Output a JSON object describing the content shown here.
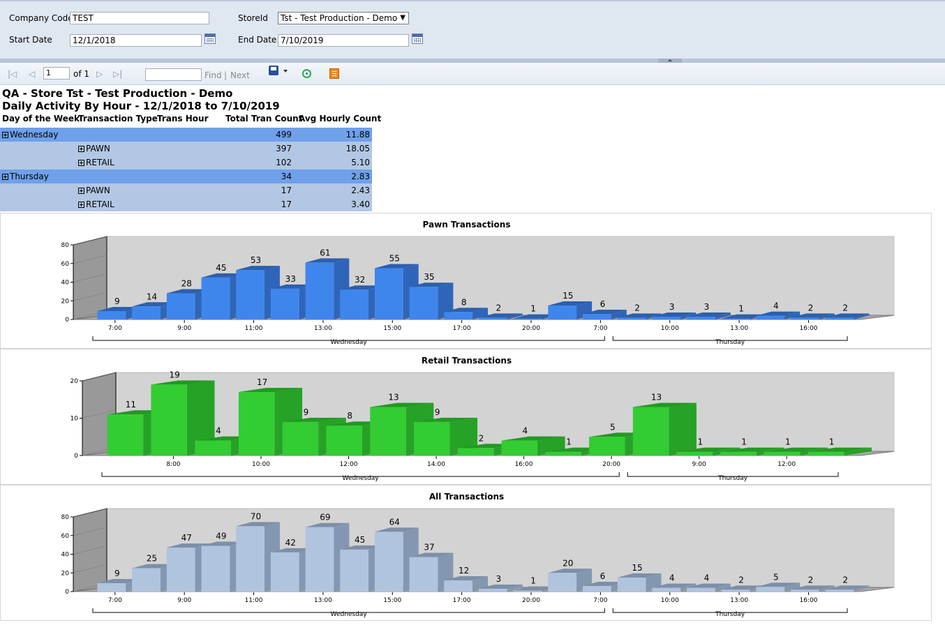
{
  "params": {
    "company_code_label": "Company Code",
    "company_code_value": "TEST",
    "store_label": "StoreId",
    "store_value": "Tst - Test Production - Demo",
    "start_date_label": "Start Date",
    "start_date_value": "12/1/2018",
    "end_date_label": "End Date",
    "end_date_value": "7/10/2019"
  },
  "toolbar": {
    "page_value": "1",
    "of_label": "of 1",
    "find_label": "Find",
    "separator": "|",
    "next_label": "Next"
  },
  "report": {
    "title_line1": "QA - Store Tst - Test Production - Demo",
    "title_line2": "Daily Activity By Hour - 12/1/2018 to  7/10/2019"
  },
  "table": {
    "headers": [
      "Day of the Week",
      "Transaction Type",
      "Trans Hour",
      "Total Tran Count",
      "Avg Hourly Count"
    ],
    "rows": [
      {
        "level": "day",
        "label": "Wednesday",
        "total": "499",
        "avg": "11.88"
      },
      {
        "level": "type",
        "label": "PAWN",
        "total": "397",
        "avg": "18.05"
      },
      {
        "level": "type",
        "label": "RETAIL",
        "total": "102",
        "avg": "5.10"
      },
      {
        "level": "day",
        "label": "Thursday",
        "total": "34",
        "avg": "2.83"
      },
      {
        "level": "type",
        "label": "PAWN",
        "total": "17",
        "avg": "2.43"
      },
      {
        "level": "type",
        "label": "RETAIL",
        "total": "17",
        "avg": "3.40"
      }
    ]
  },
  "colors": {
    "pawn_front": "#3f86ec",
    "pawn_side": "#2f65b8",
    "pawn_top": "#2c5fad",
    "retail_front": "#33cc33",
    "retail_side": "#26a226",
    "retail_top": "#229922",
    "all_front": "#b0c4de",
    "all_side": "#8497b0",
    "all_top": "#7d8fa8",
    "table_day_row": "#6fa0ea",
    "table_type_row": "#b2c7e4",
    "chart_wall": "#d3d3d3",
    "chart_side_wall": "#999999"
  },
  "chart_data": [
    {
      "type": "bar",
      "title": "Pawn Transactions",
      "ylim": [
        0,
        80
      ],
      "yticks": [
        0,
        20,
        40,
        60,
        80
      ],
      "values": [
        9,
        14,
        28,
        45,
        53,
        33,
        61,
        32,
        55,
        35,
        8,
        2,
        1,
        15,
        6,
        2,
        3,
        3,
        1,
        4,
        2,
        2
      ],
      "data_labels": [
        "9",
        "14",
        "28",
        "45",
        "53",
        "33",
        "61",
        "32",
        "55",
        "35",
        "8",
        "2",
        "1",
        "15",
        "6",
        "2",
        "3",
        "3",
        "1",
        "4",
        "2",
        "2"
      ],
      "xticks": [
        {
          "label": "7:00",
          "at": 0.5
        },
        {
          "label": "9:00",
          "at": 2.5
        },
        {
          "label": "11:00",
          "at": 4.5
        },
        {
          "label": "13:00",
          "at": 6.5
        },
        {
          "label": "15:00",
          "at": 8.5
        },
        {
          "label": "17:00",
          "at": 10.5
        },
        {
          "label": "20:00",
          "at": 12.5
        },
        {
          "label": "7:00",
          "at": 14.5
        },
        {
          "label": "10:00",
          "at": 16.5
        },
        {
          "label": "13:00",
          "at": 18.5
        },
        {
          "label": "16:00",
          "at": 20.5
        }
      ],
      "groups": [
        {
          "label": "Wednesday",
          "start": 0,
          "end": 15
        },
        {
          "label": "Thursday",
          "start": 15,
          "end": 22
        }
      ],
      "grid": false
    },
    {
      "type": "bar",
      "title": "Retail Transactions",
      "ylim": [
        0,
        20
      ],
      "yticks": [
        0,
        10,
        20
      ],
      "values": [
        11,
        19,
        4,
        17,
        9,
        8,
        13,
        9,
        2,
        4,
        1,
        5,
        13,
        1,
        1,
        1,
        1
      ],
      "data_labels": [
        "11",
        "19",
        "4",
        "17",
        "9",
        "8",
        "13",
        "9",
        "2",
        "4",
        "1",
        "5",
        "13",
        "1",
        "1",
        "1",
        "1"
      ],
      "xticks": [
        {
          "label": "8:00",
          "at": 1.5
        },
        {
          "label": "10:00",
          "at": 3.5
        },
        {
          "label": "12:00",
          "at": 5.5
        },
        {
          "label": "14:00",
          "at": 7.5
        },
        {
          "label": "16:00",
          "at": 9.5
        },
        {
          "label": "20:00",
          "at": 11.5
        },
        {
          "label": "9:00",
          "at": 13.5
        },
        {
          "label": "12:00",
          "at": 15.5
        }
      ],
      "groups": [
        {
          "label": "Wednesday",
          "start": 0,
          "end": 12
        },
        {
          "label": "Thursday",
          "start": 12,
          "end": 17
        }
      ],
      "grid": false
    },
    {
      "type": "bar",
      "title": "All Transactions",
      "ylim": [
        0,
        80
      ],
      "yticks": [
        0,
        20,
        40,
        60,
        80
      ],
      "values": [
        9,
        25,
        47,
        49,
        70,
        42,
        69,
        45,
        64,
        37,
        12,
        3,
        1,
        20,
        6,
        15,
        4,
        4,
        2,
        5,
        2,
        2
      ],
      "data_labels": [
        "9",
        "25",
        "47",
        "49",
        "70",
        "42",
        "69",
        "45",
        "64",
        "37",
        "12",
        "3",
        "1",
        "20",
        "6",
        "15",
        "4",
        "4",
        "2",
        "5",
        "2",
        "2"
      ],
      "xticks": [
        {
          "label": "7:00",
          "at": 0.5
        },
        {
          "label": "9:00",
          "at": 2.5
        },
        {
          "label": "11:00",
          "at": 4.5
        },
        {
          "label": "13:00",
          "at": 6.5
        },
        {
          "label": "15:00",
          "at": 8.5
        },
        {
          "label": "17:00",
          "at": 10.5
        },
        {
          "label": "20:00",
          "at": 12.5
        },
        {
          "label": "7:00",
          "at": 14.5
        },
        {
          "label": "10:00",
          "at": 16.5
        },
        {
          "label": "13:00",
          "at": 18.5
        },
        {
          "label": "16:00",
          "at": 20.5
        }
      ],
      "groups": [
        {
          "label": "Wednesday",
          "start": 0,
          "end": 15
        },
        {
          "label": "Thursday",
          "start": 15,
          "end": 22
        }
      ],
      "grid": false
    }
  ]
}
